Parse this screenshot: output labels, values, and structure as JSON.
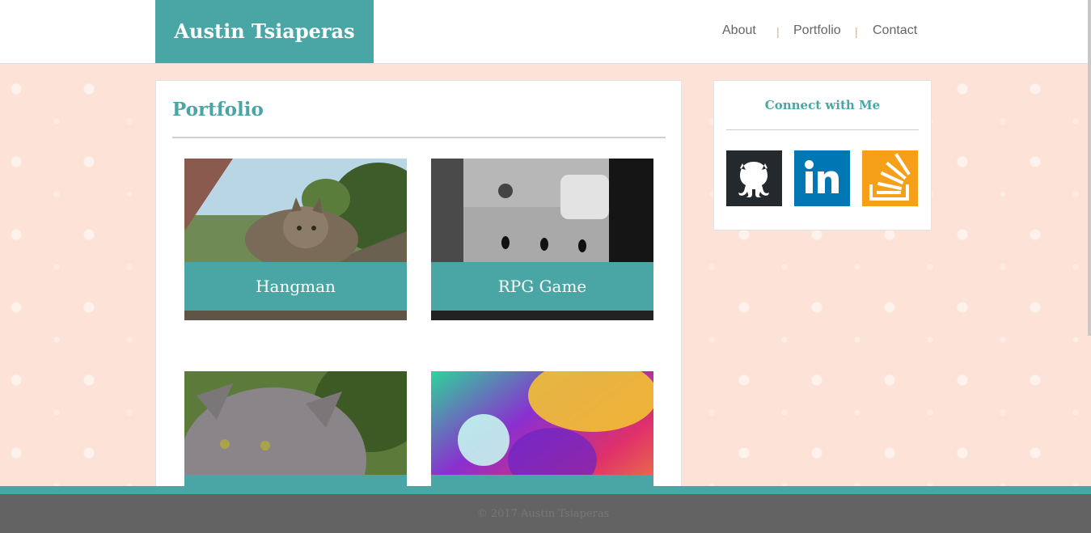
{
  "header": {
    "brand": "Austin Tsiaperas",
    "nav": [
      "About",
      "Portfolio",
      "Contact"
    ],
    "separator": "|"
  },
  "main": {
    "title": "Portfolio",
    "projects": [
      {
        "caption": "Hangman"
      },
      {
        "caption": "RPG Game"
      },
      {
        "caption": ""
      },
      {
        "caption": ""
      }
    ]
  },
  "sidebar": {
    "title": "Connect with Me",
    "links": [
      {
        "icon": "github-icon",
        "color": "#24292e"
      },
      {
        "icon": "linkedin-icon",
        "color": "#0077b5"
      },
      {
        "icon": "stackoverflow-icon",
        "color": "#f6a01a"
      }
    ]
  },
  "footer": {
    "text": "© 2017 Austin Tsiaperas"
  },
  "colors": {
    "accent": "#4aa6a4",
    "background": "#fde3d7",
    "footer": "#636363"
  }
}
